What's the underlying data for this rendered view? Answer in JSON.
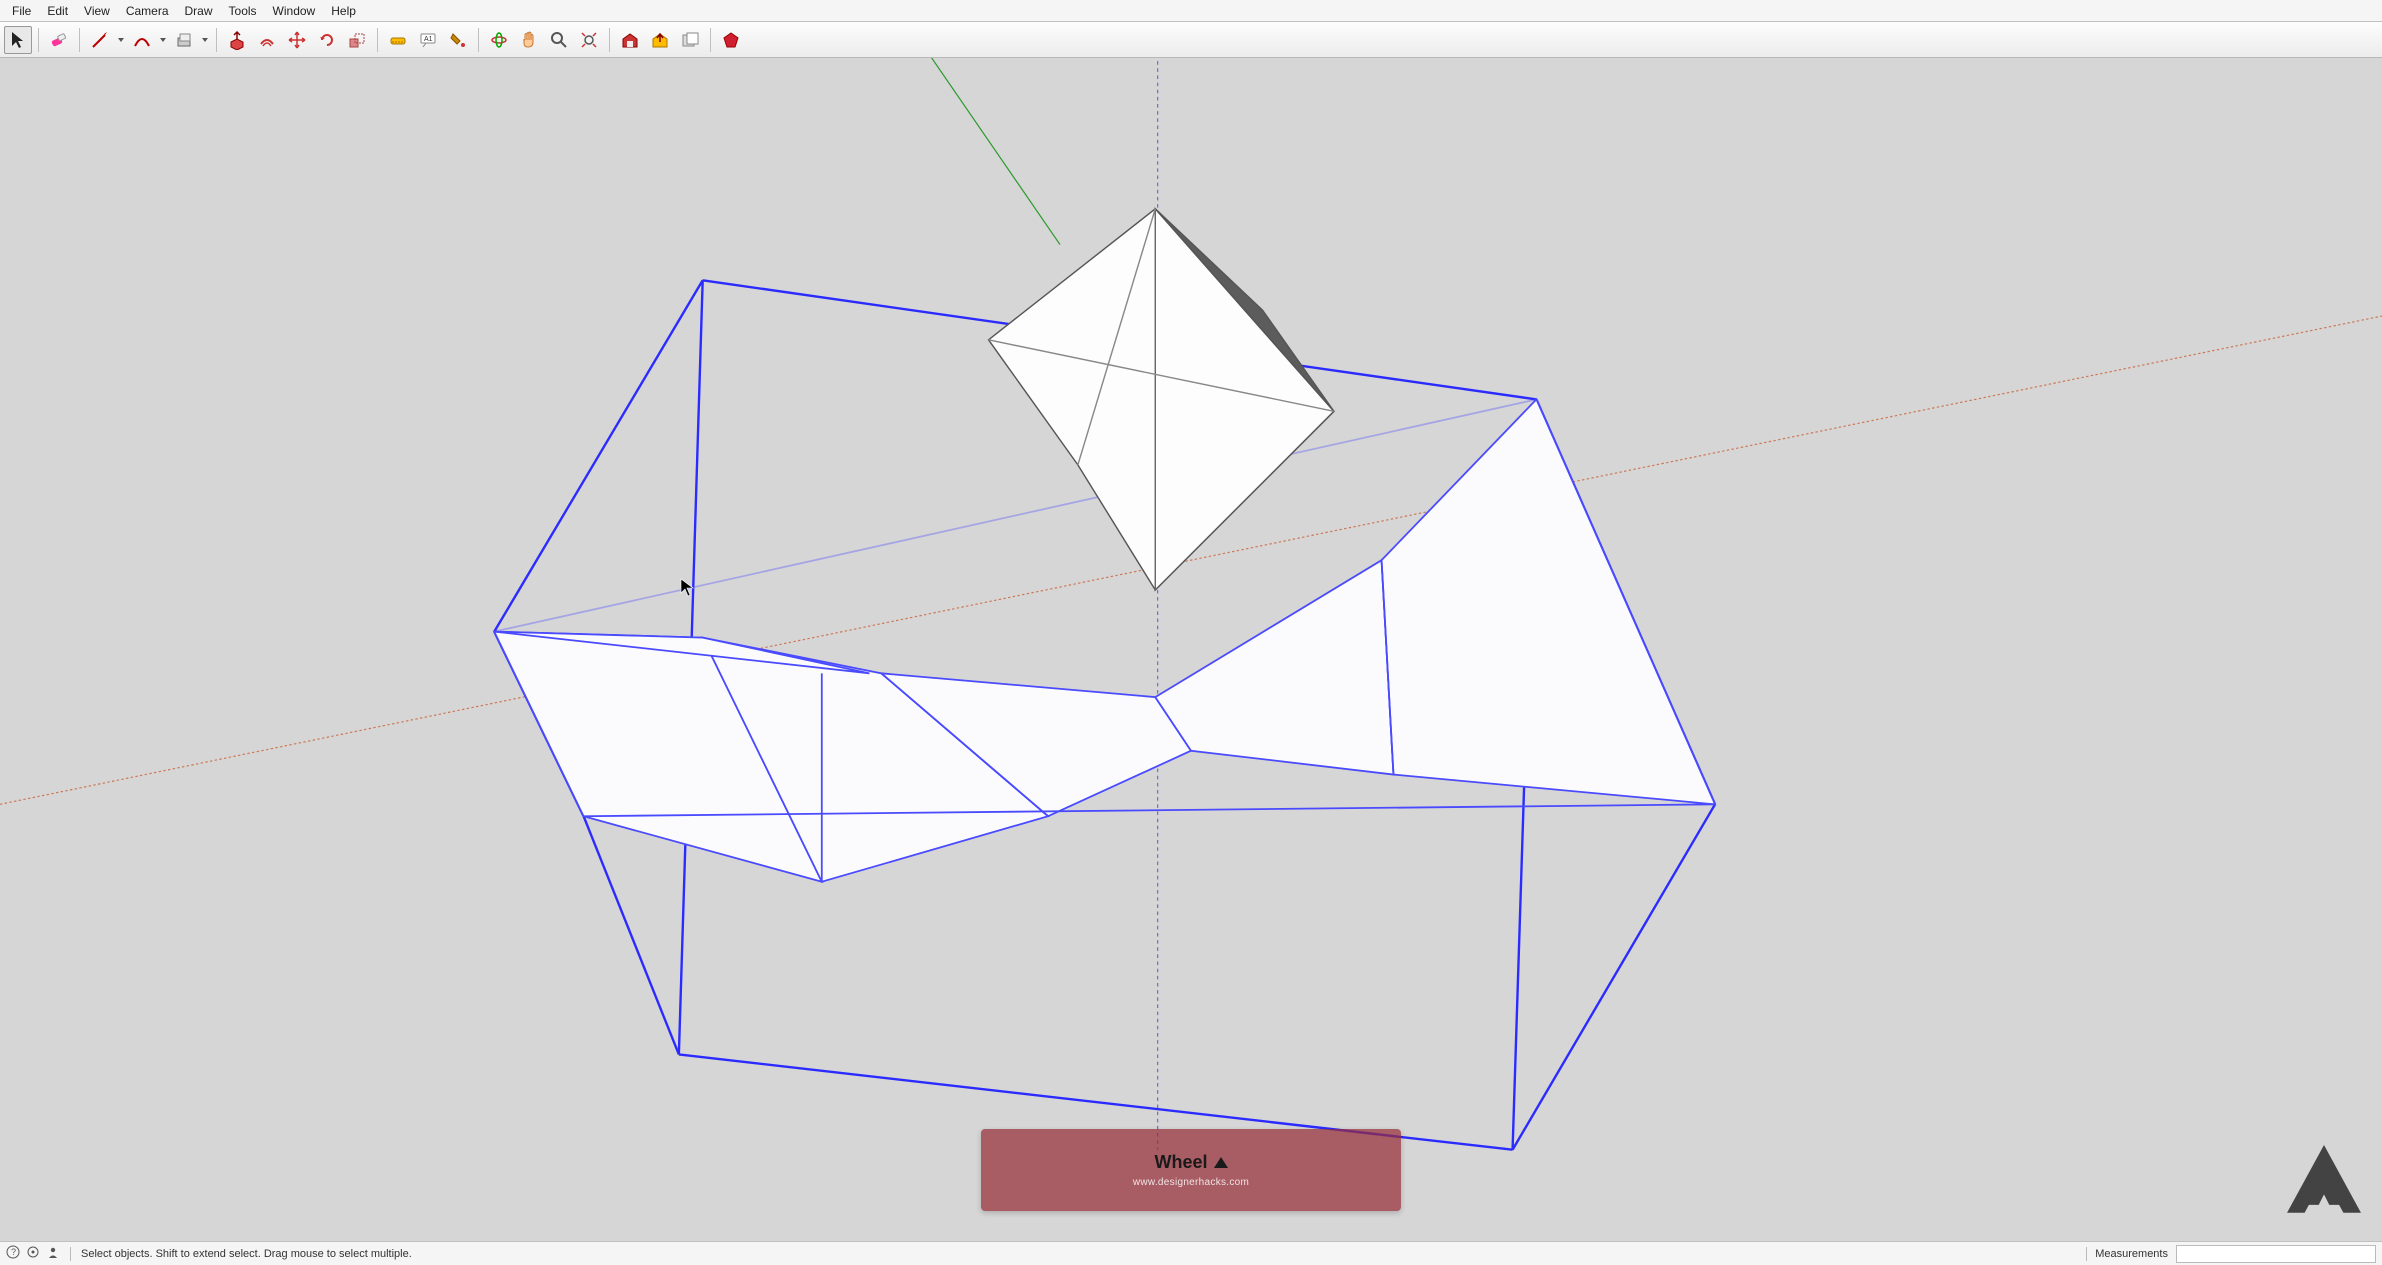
{
  "menu": {
    "file": "File",
    "edit": "Edit",
    "view": "View",
    "camera": "Camera",
    "draw": "Draw",
    "tools": "Tools",
    "window": "Window",
    "help": "Help"
  },
  "toolbar": {
    "select": "select",
    "eraser": "eraser",
    "line": "line",
    "arc": "arc",
    "shapes": "shapes",
    "pushpull": "pushpull",
    "offset": "offset",
    "move": "move",
    "rotate": "rotate",
    "scale": "scale",
    "tape": "tape",
    "text": "text",
    "paint": "paint",
    "orbit": "orbit",
    "pan": "pan",
    "zoom": "zoom",
    "zoom_extents": "zoom_extents",
    "warehouse": "warehouse",
    "share_model": "share_model",
    "layers": "layers",
    "ruby": "ruby"
  },
  "overlay": {
    "title": "Wheel",
    "subtitle": "www.designerhacks.com"
  },
  "status": {
    "hint": "Select objects. Shift to extend select. Drag mouse to select multiple.",
    "measurements_label": "Measurements"
  }
}
